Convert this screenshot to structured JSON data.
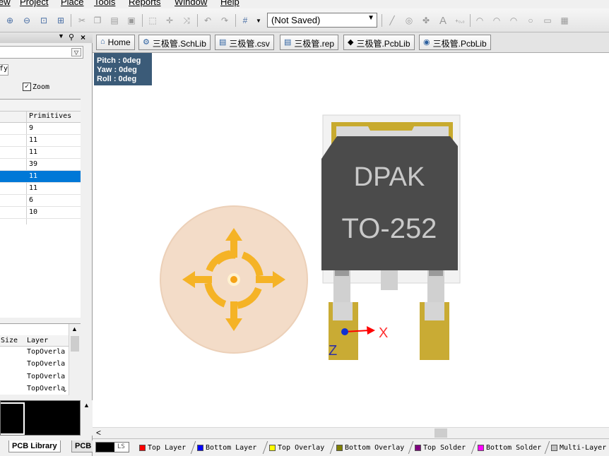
{
  "menu": [
    "ew",
    "Project",
    "Place",
    "Tools",
    "Reports",
    "Window",
    "Help"
  ],
  "toolbar": {
    "mode_value": "(Not Saved)"
  },
  "left_panel": {
    "zoom_label": "Zoom",
    "components_header": "Primitives",
    "primitive_counts": [
      "9",
      "11",
      "11",
      "39",
      "11",
      "11",
      "6",
      "10"
    ],
    "selected_index": 4,
    "primitives_headers": {
      "size": "Size",
      "layer": "Layer"
    },
    "primitive_layers": [
      "TopOverla",
      "TopOverla",
      "TopOverla",
      "TopOverla"
    ],
    "tabs": [
      "PCB Library",
      "PCB"
    ]
  },
  "doc_tabs": [
    {
      "label": "Home",
      "icon": "home-icon"
    },
    {
      "label": "三极管.SchLib",
      "icon": "schlib-icon"
    },
    {
      "label": "三极管.csv",
      "icon": "document-icon"
    },
    {
      "label": "三极管.rep",
      "icon": "document-icon"
    },
    {
      "label": "三极管.PcbLib",
      "icon": "pcblib-icon"
    },
    {
      "label": "三极管.PcbLib",
      "icon": "pcblib-icon"
    }
  ],
  "view_orientation": {
    "pitch": "Pitch : 0deg",
    "yaw": "Yaw : 0deg",
    "roll": "Roll : 0deg"
  },
  "component": {
    "package_name": "DPAK",
    "package_code": "TO-252",
    "axis_x": "X",
    "axis_z": "Z"
  },
  "layers": {
    "ls_label": "LS",
    "items": [
      {
        "name": "Top Layer",
        "color": "#ff0000"
      },
      {
        "name": "Bottom Layer",
        "color": "#0000ff"
      },
      {
        "name": "Top Overlay",
        "color": "#ffff00"
      },
      {
        "name": "Bottom Overlay",
        "color": "#808000"
      },
      {
        "name": "Top Solder",
        "color": "#800080"
      },
      {
        "name": "Bottom Solder",
        "color": "#ff00ff"
      },
      {
        "name": "Multi-Layer",
        "color": "#c0c0c0"
      }
    ]
  }
}
